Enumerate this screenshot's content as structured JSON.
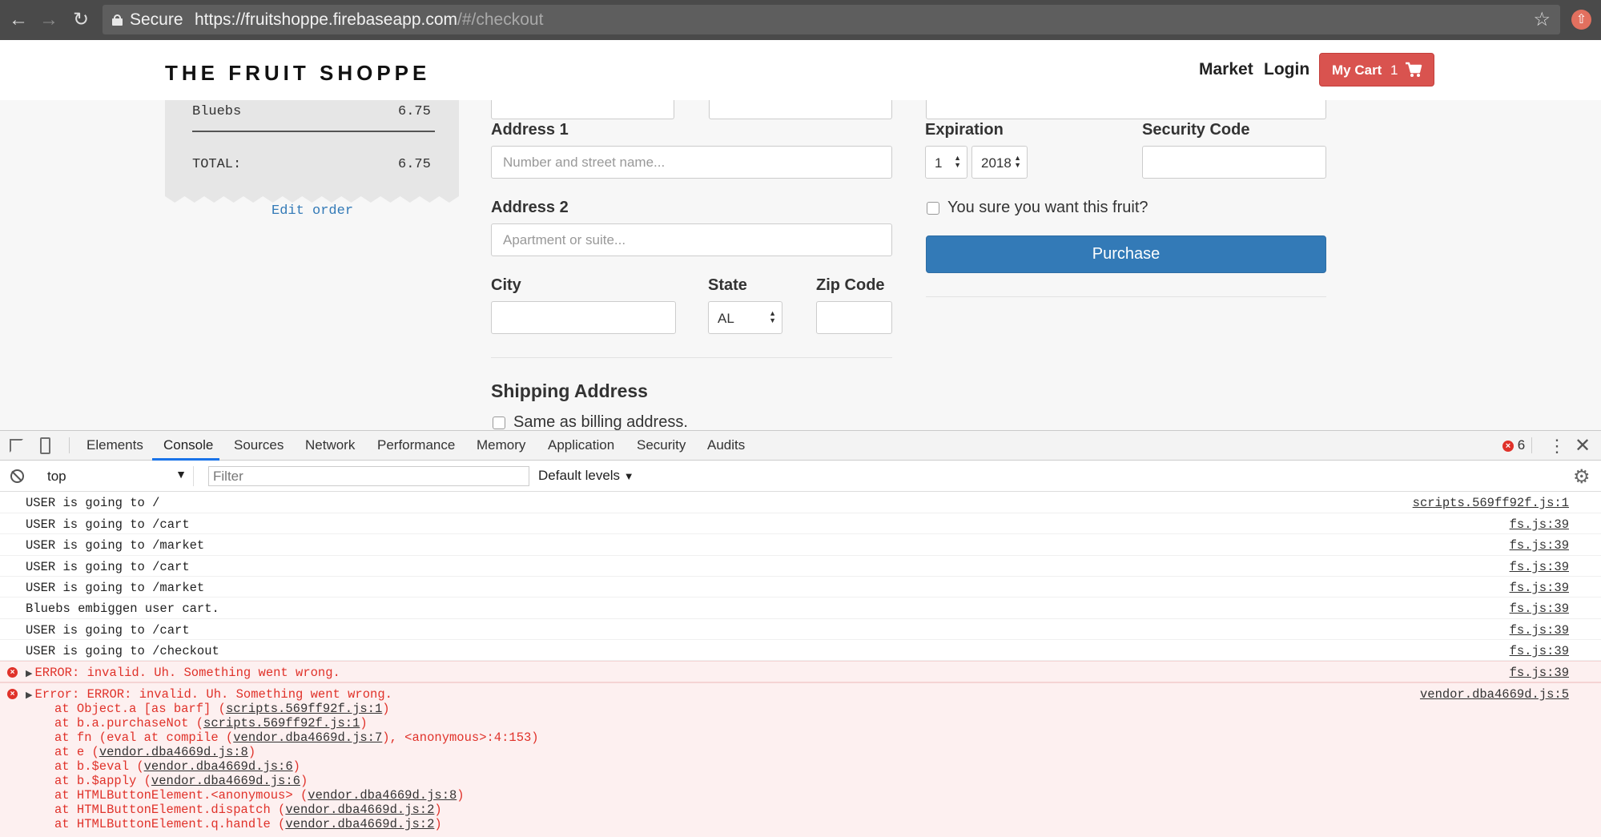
{
  "browser": {
    "secure_label": "Secure",
    "url_base": "https://fruitshoppe.firebaseapp.com",
    "url_path": "/#/checkout"
  },
  "header": {
    "brand": "THE FRUIT SHOPPE",
    "nav": {
      "market": "Market",
      "login": "Login"
    },
    "cart": {
      "label": "My Cart",
      "count": "1"
    }
  },
  "receipt": {
    "items": [
      {
        "name": "Bluebs",
        "price": "6.75"
      }
    ],
    "total_label": "TOTAL:",
    "total_value": "6.75",
    "edit_link": "Edit order"
  },
  "billing": {
    "address1": {
      "label": "Address 1",
      "placeholder": "Number and street name..."
    },
    "address2": {
      "label": "Address 2",
      "placeholder": "Apartment or suite..."
    },
    "city": {
      "label": "City",
      "value": ""
    },
    "state": {
      "label": "State",
      "value": "AL"
    },
    "zip": {
      "label": "Zip Code",
      "value": ""
    }
  },
  "payment": {
    "expiration": {
      "label": "Expiration",
      "month": "1",
      "year": "2018"
    },
    "security_code": {
      "label": "Security Code",
      "value": ""
    },
    "confirm_label": "You sure you want this fruit?",
    "purchase_label": "Purchase"
  },
  "shipping": {
    "title": "Shipping Address",
    "same_as_billing": "Same as billing address."
  },
  "devtools": {
    "tabs": [
      "Elements",
      "Console",
      "Sources",
      "Network",
      "Performance",
      "Memory",
      "Application",
      "Security",
      "Audits"
    ],
    "active_tab": "Console",
    "error_count": "6",
    "context": "top",
    "filter_placeholder": "Filter",
    "levels": "Default levels",
    "logs": [
      {
        "msg": "USER is going to /",
        "src": "scripts.569ff92f.js:1"
      },
      {
        "msg": "USER is going to /cart",
        "src": "fs.js:39"
      },
      {
        "msg": "USER is going to /market",
        "src": "fs.js:39"
      },
      {
        "msg": "USER is going to /cart",
        "src": "fs.js:39"
      },
      {
        "msg": "USER is going to /market",
        "src": "fs.js:39"
      },
      {
        "msg": "Bluebs embiggen user cart.",
        "src": "fs.js:39"
      },
      {
        "msg": "USER is going to /cart",
        "src": "fs.js:39"
      },
      {
        "msg": "USER is going to /checkout",
        "src": "fs.js:39"
      }
    ],
    "error1": {
      "msg": "ERROR: invalid. Uh. Something went wrong.",
      "src": "fs.js:39"
    },
    "error2": {
      "msg": "Error: ERROR: invalid. Uh. Something went wrong.",
      "src": "vendor.dba4669d.js:5",
      "stack": [
        {
          "pre": "at Object.a [as barf] (",
          "link": "scripts.569ff92f.js:1",
          "post": ")"
        },
        {
          "pre": "at b.a.purchaseNot (",
          "link": "scripts.569ff92f.js:1",
          "post": ")"
        },
        {
          "pre": "at fn (eval at compile (",
          "link": "vendor.dba4669d.js:7",
          "post": "), <anonymous>:4:153)"
        },
        {
          "pre": "at e (",
          "link": "vendor.dba4669d.js:8",
          "post": ")"
        },
        {
          "pre": "at b.$eval (",
          "link": "vendor.dba4669d.js:6",
          "post": ")"
        },
        {
          "pre": "at b.$apply (",
          "link": "vendor.dba4669d.js:6",
          "post": ")"
        },
        {
          "pre": "at HTMLButtonElement.<anonymous> (",
          "link": "vendor.dba4669d.js:8",
          "post": ")"
        },
        {
          "pre": "at HTMLButtonElement.dispatch (",
          "link": "vendor.dba4669d.js:2",
          "post": ")"
        },
        {
          "pre": "at HTMLButtonElement.q.handle (",
          "link": "vendor.dba4669d.js:2",
          "post": ")"
        }
      ]
    }
  },
  "colors": {
    "danger": "#d9534f",
    "primary": "#337ab7",
    "console_error": "#e0322a"
  }
}
